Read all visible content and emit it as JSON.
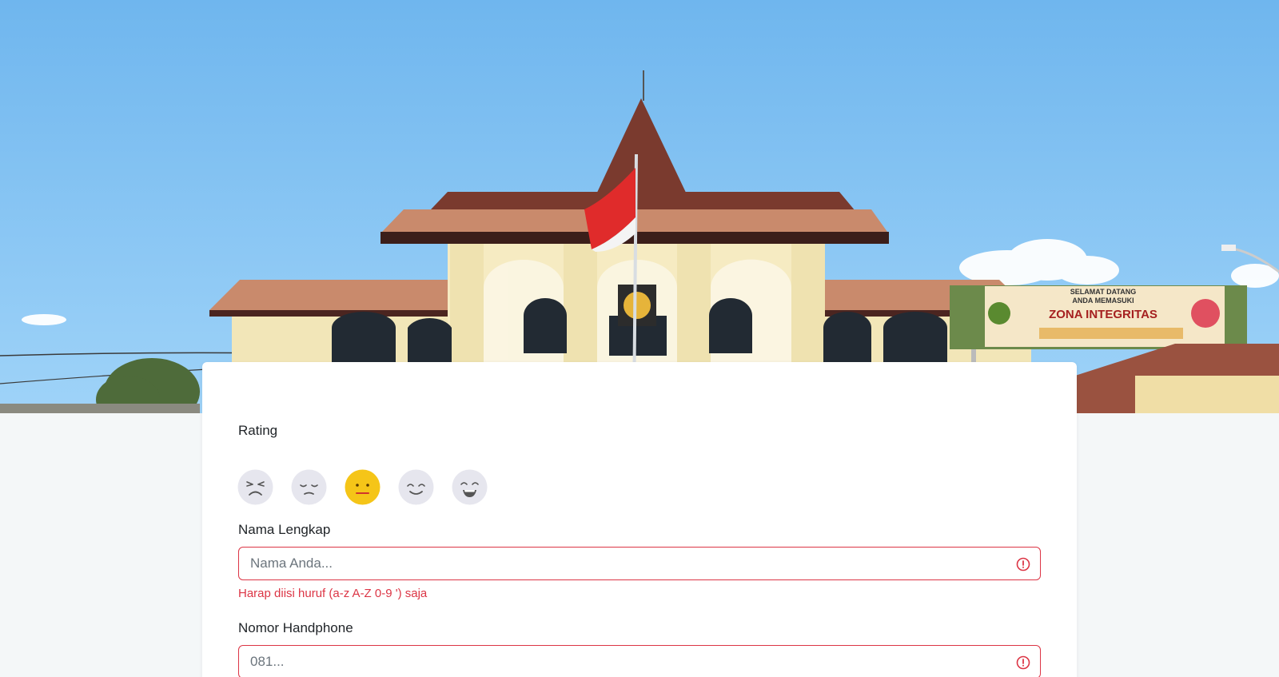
{
  "hero": {
    "image": "courthouse-building-photo",
    "banner_text": [
      "SELAMAT DATANG",
      "ANDA MEMASUKI",
      "ZONA INTEGRITAS"
    ]
  },
  "form": {
    "rating_label": "Rating",
    "rating_options": [
      {
        "name": "very-unsatisfied-face-icon",
        "selected": false
      },
      {
        "name": "unsatisfied-face-icon",
        "selected": false
      },
      {
        "name": "neutral-face-icon",
        "selected": true
      },
      {
        "name": "satisfied-face-icon",
        "selected": false
      },
      {
        "name": "very-satisfied-face-icon",
        "selected": false
      }
    ],
    "name_label": "Nama Lengkap",
    "name_placeholder": "Nama Anda...",
    "name_value": "",
    "name_error": "Harap diisi huruf (a-z A-Z 0-9 ') saja",
    "phone_label": "Nomor Handphone",
    "phone_placeholder": "081...",
    "phone_value": ""
  },
  "colors": {
    "error": "#dc3545",
    "selected_face": "#f5c518",
    "unselected_face": "#e6e6ee",
    "page_bg": "#f4f7f8"
  }
}
